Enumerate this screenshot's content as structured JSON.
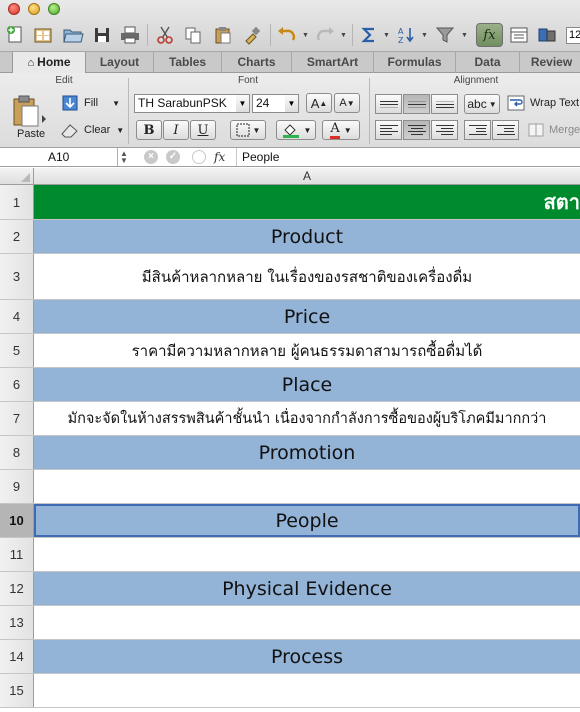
{
  "toolbar": {
    "zoom_value": "12",
    "fx_label": "fx"
  },
  "ribbon_tabs": [
    {
      "label": "Home",
      "active": true
    },
    {
      "label": "Layout"
    },
    {
      "label": "Tables"
    },
    {
      "label": "Charts"
    },
    {
      "label": "SmartArt"
    },
    {
      "label": "Formulas"
    },
    {
      "label": "Data"
    },
    {
      "label": "Review"
    }
  ],
  "ribbon": {
    "edit_group": "Edit",
    "paste_label": "Paste",
    "fill_label": "Fill",
    "clear_label": "Clear",
    "font_group": "Font",
    "font_name": "TH SarabunPSK",
    "font_size": "24",
    "bold": "B",
    "italic": "I",
    "underline": "U",
    "font_color_glyph": "A",
    "grow_font": "A",
    "shrink_font": "A",
    "alignment_group": "Alignment",
    "text_direction": "abc",
    "wrap_text": "Wrap Text",
    "merge": "Merge"
  },
  "formula_bar": {
    "cell_ref": "A10",
    "fx": "fx",
    "content": "People"
  },
  "column_header": "A",
  "rows": [
    {
      "num": "1",
      "text": "สตา",
      "style": "green"
    },
    {
      "num": "2",
      "text": "Product",
      "style": "blue"
    },
    {
      "num": "3",
      "text": "มีสินค้าหลากหลาย ในเรื่องของรสชาติของเครื่องดื่ม",
      "style": "white"
    },
    {
      "num": "4",
      "text": "Price",
      "style": "blue"
    },
    {
      "num": "5",
      "text": "ราคามีความหลากหลาย ผู้คนธรรมดาสามารถซื้อดื่มได้",
      "style": "white"
    },
    {
      "num": "6",
      "text": "Place",
      "style": "blue"
    },
    {
      "num": "7",
      "text": "มักจะจัดในห้างสรรพสินค้าชั้นนำ เนื่องจากกำลังการซื้อของผู้บริโภคมีมากกว่า",
      "style": "white"
    },
    {
      "num": "8",
      "text": "Promotion",
      "style": "blue"
    },
    {
      "num": "9",
      "text": "",
      "style": "white"
    },
    {
      "num": "10",
      "text": "People",
      "style": "blue",
      "selected": true
    },
    {
      "num": "11",
      "text": "",
      "style": "white"
    },
    {
      "num": "12",
      "text": "Physical Evidence",
      "style": "blue"
    },
    {
      "num": "13",
      "text": "",
      "style": "white"
    },
    {
      "num": "14",
      "text": "Process",
      "style": "blue"
    },
    {
      "num": "15",
      "text": "",
      "style": "white"
    }
  ],
  "colors": {
    "header_green": "#008a2e",
    "band_blue": "#93b3d7",
    "selection": "#3e6bb4"
  }
}
